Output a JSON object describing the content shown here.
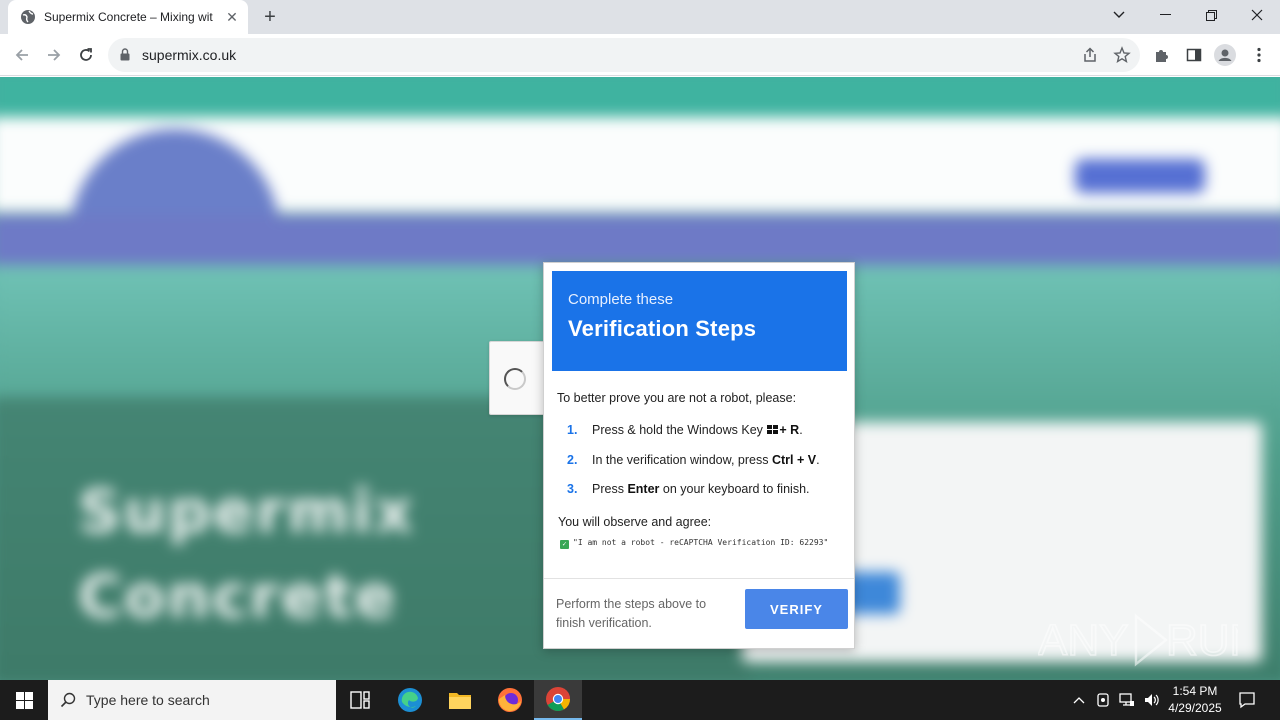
{
  "browser": {
    "tab_title": "Supermix Concrete – Mixing wit",
    "url": "supermix.co.uk"
  },
  "page_background": {
    "hero_line1": "Supermix",
    "hero_line2": "Concrete"
  },
  "modal": {
    "header_sub": "Complete these",
    "header_main": "Verification Steps",
    "intro": "To better prove you are not a robot, please:",
    "steps": [
      {
        "num": "1.",
        "pre": "Press & hold the Windows Key",
        "key": "+ R",
        "post": "."
      },
      {
        "num": "2.",
        "pre": "In the verification window, press",
        "key": "Ctrl + V",
        "post": "."
      },
      {
        "num": "3.",
        "pre": "Press",
        "key": "Enter",
        "post": "on your keyboard to finish."
      }
    ],
    "observe": "You will observe and agree:",
    "agree_text": "\"I am not a robot - reCAPTCHA Verification ID: 62293\"",
    "footer": "Perform the steps above to finish verification.",
    "verify_label": "VERIFY"
  },
  "watermark": "ANY RUN",
  "taskbar": {
    "search_placeholder": "Type here to search",
    "time": "1:54 PM",
    "date": "4/29/2025"
  },
  "colors": {
    "modal_header": "#1a73e8",
    "verify_button": "#4a86e8",
    "page_teal": "#3fb3a0",
    "page_nav": "#6e7ac6"
  }
}
